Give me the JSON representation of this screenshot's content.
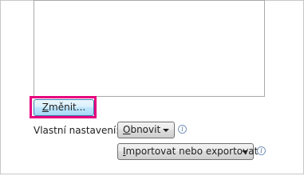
{
  "change_button": {
    "label_first": "Z",
    "label_rest": "měnit..."
  },
  "custom_settings": {
    "label": "Vlastní nastavení:",
    "reset_button": {
      "label_first": "O",
      "label_rest": "bnovit"
    },
    "import_export_button": {
      "label_first": "I",
      "label_rest": "mportovat nebo exportovat"
    },
    "info_glyph": "i"
  },
  "icons": {
    "dropdown": "chevron-down-icon",
    "info": "info-icon"
  },
  "colors": {
    "highlight": "#e6007e",
    "focused_button_border": "#3c7fb1"
  }
}
